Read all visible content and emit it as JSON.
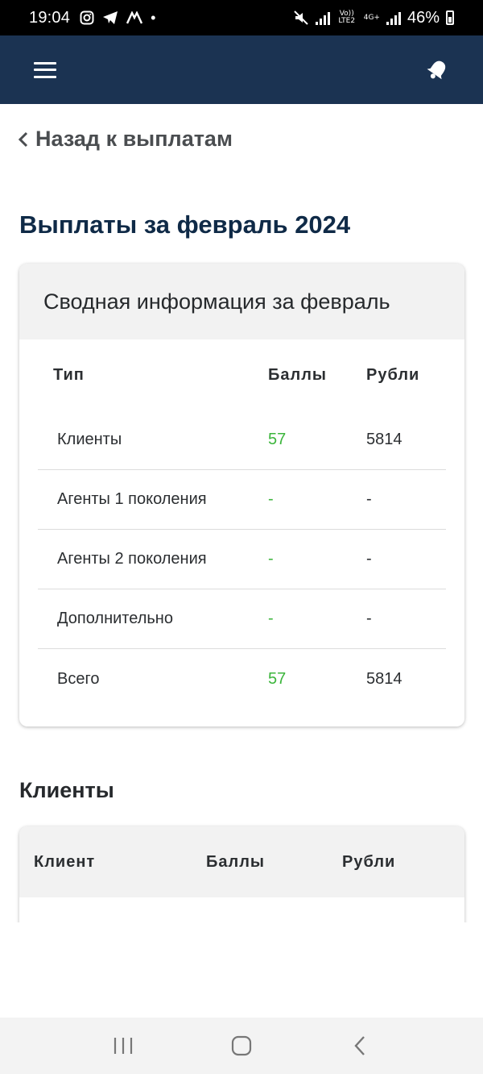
{
  "status_bar": {
    "time": "19:04",
    "dot": "•",
    "volte": "Vo)) LTE2",
    "network": "4G+",
    "battery": "46%"
  },
  "header": {
    "menu_icon": "hamburger-menu-icon",
    "bell_icon": "bell-icon"
  },
  "nav": {
    "back_label": "Назад к выплатам"
  },
  "page": {
    "title": "Выплаты за февраль 2024"
  },
  "summary": {
    "card_title": "Сводная информация за февраль",
    "columns": [
      "Тип",
      "Баллы",
      "Рубли"
    ],
    "rows": [
      {
        "type": "Клиенты",
        "points": "57",
        "rub": "5814"
      },
      {
        "type": "Агенты 1 поколения",
        "points": "-",
        "rub": "-"
      },
      {
        "type": "Агенты 2 поколения",
        "points": "-",
        "rub": "-"
      },
      {
        "type": "Дополнительно",
        "points": "-",
        "rub": "-"
      },
      {
        "type": "Всего",
        "points": "57",
        "rub": "5814"
      }
    ]
  },
  "clients": {
    "section_title": "Клиенты",
    "columns": [
      "Клиент",
      "Баллы",
      "Рубли"
    ]
  },
  "colors": {
    "header_bg": "#1b3352",
    "title": "#0f2a47",
    "points_green": "#3cb53c"
  }
}
